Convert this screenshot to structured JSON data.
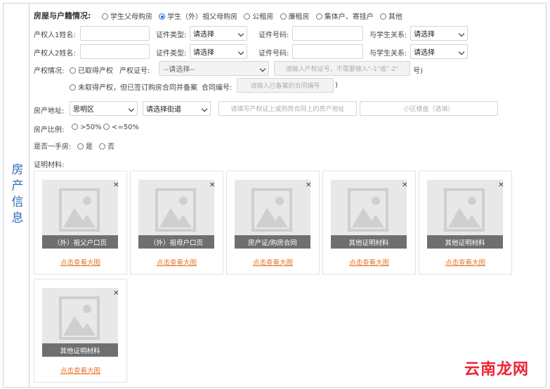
{
  "section": {
    "side_label": "房产信息"
  },
  "row_type": {
    "title": "房屋与户籍情况:",
    "options": [
      "学生父母购房",
      "学生（外）祖父母购房",
      "公租房",
      "廉租房",
      "集体户、寄挂户",
      "其他"
    ],
    "selected_index": 1
  },
  "owner1": {
    "name_label": "产权人1姓名:",
    "cert_type_label": "证件类型:",
    "cert_type_value": "请选择",
    "cert_no_label": "证件号码:",
    "relation_label": "与学生关系:",
    "relation_value": "请选择"
  },
  "owner2": {
    "name_label": "产权人2姓名:",
    "cert_type_label": "证件类型:",
    "cert_type_value": "请选择",
    "cert_no_label": "证件号码:",
    "relation_label": "与学生关系:",
    "relation_value": "请选择"
  },
  "property": {
    "label": "产权情况:",
    "opt1": "已取得产权",
    "cert_label": "产权证号:",
    "cert_select": "--请选择--",
    "cert_placeholder": "请输入产权证号，不需要输入\"-1\"或\"-2\"",
    "cert_suffix": "号)",
    "opt2": "未取得产权，但已签订购房合同并备案",
    "contract_label": "合同编号:",
    "contract_placeholder": "请输入已备案的合同编号",
    "contract_suffix": ")"
  },
  "address": {
    "label": "房产地址:",
    "district": "思明区",
    "street": "请选择街道",
    "address_placeholder": "请填写产权证上或购房合同上的房产地址",
    "community_placeholder": "小区楼盘（选填）"
  },
  "ratio": {
    "label": "房产比例:",
    "opt1": ">50%",
    "opt2": "<=50%"
  },
  "firsthand": {
    "label": "是否一手房:",
    "yes": "是",
    "no": "否"
  },
  "materials": {
    "label": "证明材料:",
    "items": [
      {
        "caption": "（外）祖父户口页",
        "link": "点击查看大图"
      },
      {
        "caption": "（外）祖母户口页",
        "link": "点击查看大图"
      },
      {
        "caption": "房产证/购房合同",
        "link": "点击查看大图"
      },
      {
        "caption": "其他证明材料",
        "link": "点击查看大图"
      },
      {
        "caption": "其他证明材料",
        "link": "点击查看大图"
      },
      {
        "caption": "其他证明材料",
        "link": "点击查看大图"
      }
    ],
    "close": "×"
  },
  "watermark": "云南龙网",
  "colors": {
    "accent": "#2a6bb5",
    "link": "#e8742a",
    "radio": "#1a73e8"
  }
}
